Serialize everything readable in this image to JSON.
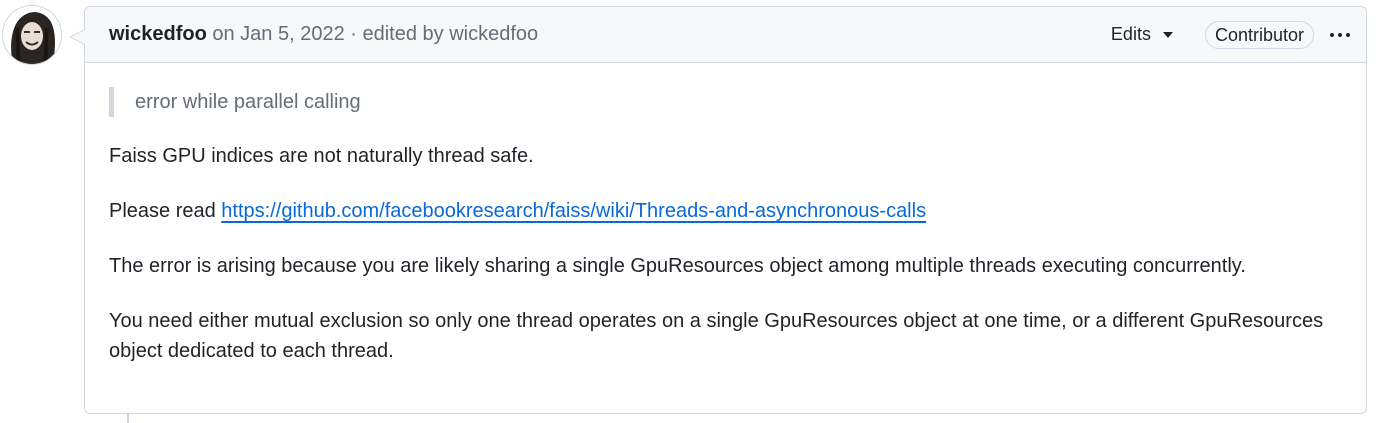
{
  "comment": {
    "author": "wickedfoo",
    "date_text": " on Jan 5, 2022 · edited by ",
    "editor": "wickedfoo",
    "edits_label": "Edits",
    "role_badge": "Contributor",
    "quote": "error while parallel calling",
    "paragraphs": {
      "p1": "Faiss GPU indices are not naturally thread safe.",
      "p2_prefix": "Please read ",
      "p2_link": "https://github.com/facebookresearch/faiss/wiki/Threads-and-asynchronous-calls",
      "p3": "The error is arising because you are likely sharing a single GpuResources object among multiple threads executing concurrently.",
      "p4": "You need either mutual exclusion so only one thread operates on a single GpuResources object at one time, or a different GpuResources object dedicated to each thread."
    }
  },
  "icons": {
    "avatar": "user-avatar",
    "edits_caret": "chevron-down-icon",
    "more": "kebab-horizontal-icon"
  },
  "colors": {
    "border": "#d0d7de",
    "header_bg": "#f6f8fa",
    "muted_text": "#656d76",
    "link": "#0969da",
    "text": "#1f2328"
  }
}
